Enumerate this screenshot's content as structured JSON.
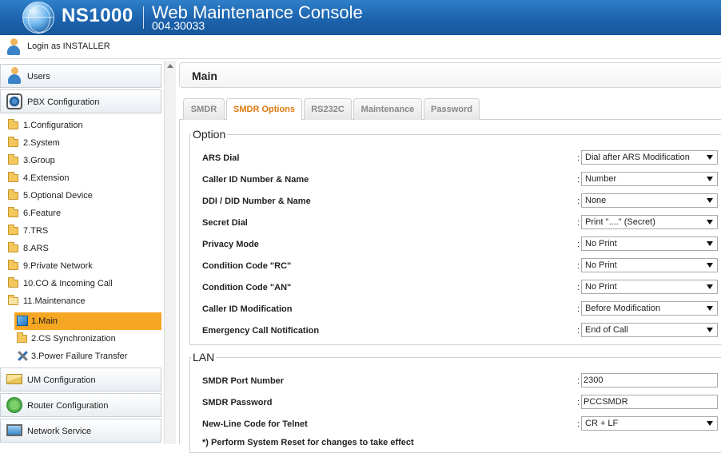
{
  "header": {
    "brand": "NS1000",
    "app_title": "Web Maintenance Console",
    "version": "004.30033"
  },
  "login": {
    "text": "Login as INSTALLER"
  },
  "sidebar": {
    "sections": {
      "users": "Users",
      "pbx": "PBX Configuration",
      "um": "UM Configuration",
      "router": "Router Configuration",
      "network": "Network Service"
    },
    "items": [
      "1.Configuration",
      "2.System",
      "3.Group",
      "4.Extension",
      "5.Optional Device",
      "6.Feature",
      "7.TRS",
      "8.ARS",
      "9.Private Network",
      "10.CO & Incoming Call",
      "11.Maintenance"
    ],
    "subitems": [
      "1.Main",
      "2.CS Synchronization",
      "3.Power Failure Transfer"
    ]
  },
  "main": {
    "title": "Main",
    "tabs": [
      "SMDR",
      "SMDR Options",
      "RS232C",
      "Maintenance",
      "Password"
    ],
    "active_tab": "SMDR Options",
    "option": {
      "legend": "Option",
      "rows": [
        {
          "label": "ARS Dial",
          "value": "Dial after ARS Modification"
        },
        {
          "label": "Caller ID Number & Name",
          "value": "Number"
        },
        {
          "label": "DDI / DID Number & Name",
          "value": "None"
        },
        {
          "label": "Secret Dial",
          "value": "Print \"....\" (Secret)"
        },
        {
          "label": "Privacy Mode",
          "value": "No Print"
        },
        {
          "label": "Condition Code \"RC\"",
          "value": "No Print"
        },
        {
          "label": "Condition Code \"AN\"",
          "value": "No Print"
        },
        {
          "label": "Caller ID Modification",
          "value": "Before Modification"
        },
        {
          "label": "Emergency Call Notification",
          "value": "End of Call"
        }
      ]
    },
    "lan": {
      "legend": "LAN",
      "port_label": "SMDR Port Number",
      "port_value": "2300",
      "password_label": "SMDR Password",
      "password_value": "PCCSMDR",
      "newline_label": "New-Line Code for Telnet",
      "newline_value": "CR + LF"
    },
    "note": "*) Perform System Reset for changes to take effect"
  },
  "colors": {
    "header": "#1c63ad",
    "active_item": "#f5a623",
    "active_tab_text": "#e07a10"
  }
}
